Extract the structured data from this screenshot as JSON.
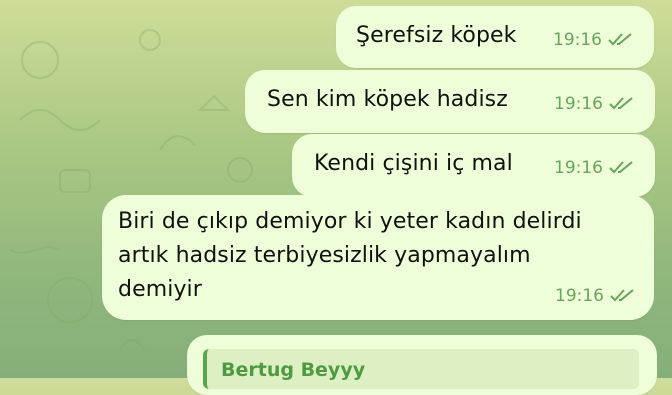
{
  "chat": {
    "messages": [
      {
        "text": "Şerefsiz köpek",
        "time": "19:16",
        "status_icon": "double-check-icon"
      },
      {
        "text": "Sen kim köpek hadisz",
        "time": "19:16",
        "status_icon": "double-check-icon"
      },
      {
        "text": "Kendi çişini iç mal",
        "time": "19:16",
        "status_icon": "double-check-icon"
      },
      {
        "lines": [
          "Biri de çıkıp demiyor ki yeter kadın delirdi",
          "artık hadsiz terbiyesizlik yapmayalım",
          "demiyir"
        ],
        "time": "19:16",
        "status_icon": "double-check-icon"
      }
    ],
    "reply": {
      "sender_name": "Bertug Beyyy"
    }
  },
  "colors": {
    "bubble": "#eefed9",
    "time": "#6aa35b",
    "reply_name": "#4f9a40",
    "background": "#a9c783"
  }
}
